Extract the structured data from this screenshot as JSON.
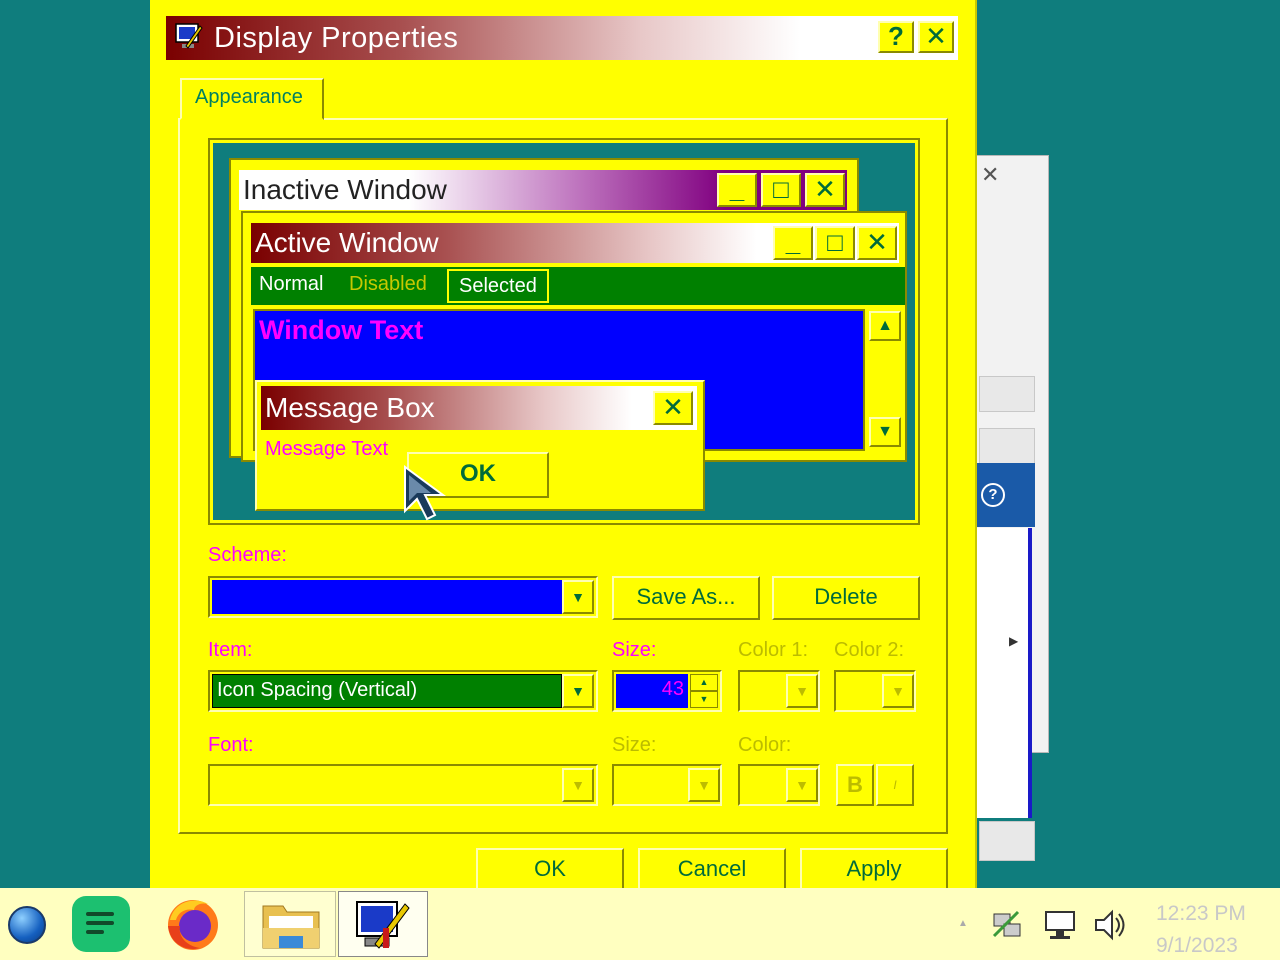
{
  "dialog": {
    "title": "Display Properties",
    "help_label": "?",
    "close_label": "✕",
    "tab_label": "Appearance"
  },
  "preview": {
    "inactive_title": "Inactive Window",
    "active_title": "Active Window",
    "menu_normal": "Normal",
    "menu_disabled": "Disabled",
    "menu_selected": "Selected",
    "window_text": "Window Text",
    "msgbox_title": "Message Box",
    "msgbox_text": "Message Text",
    "ok_label": "OK",
    "minimize_glyph": "_",
    "maximize_glyph": "□",
    "close_glyph": "✕"
  },
  "form": {
    "scheme_label": "Scheme:",
    "scheme_value": "",
    "save_as_label": "Save As...",
    "delete_label": "Delete",
    "item_label": "Item:",
    "item_value": "Icon Spacing (Vertical)",
    "size_label": "Size:",
    "size_value": "43",
    "color1_label": "Color 1:",
    "color2_label": "Color 2:",
    "font_label": "Font:",
    "font_size_label": "Size:",
    "font_color_label": "Color:",
    "bold_label": "B",
    "italic_label": "I"
  },
  "buttons": {
    "ok": "OK",
    "cancel": "Cancel",
    "apply": "Apply"
  },
  "taskbar": {
    "time": "12:23 PM",
    "date": "9/1/2023"
  },
  "colors": {
    "desktop": "#0f7d7d",
    "dialog_face": "#ffff00",
    "accent_text": "#006b3a",
    "label_text": "#ff00ff",
    "window_bg": "#0000ff",
    "menu_bg": "#008000"
  }
}
